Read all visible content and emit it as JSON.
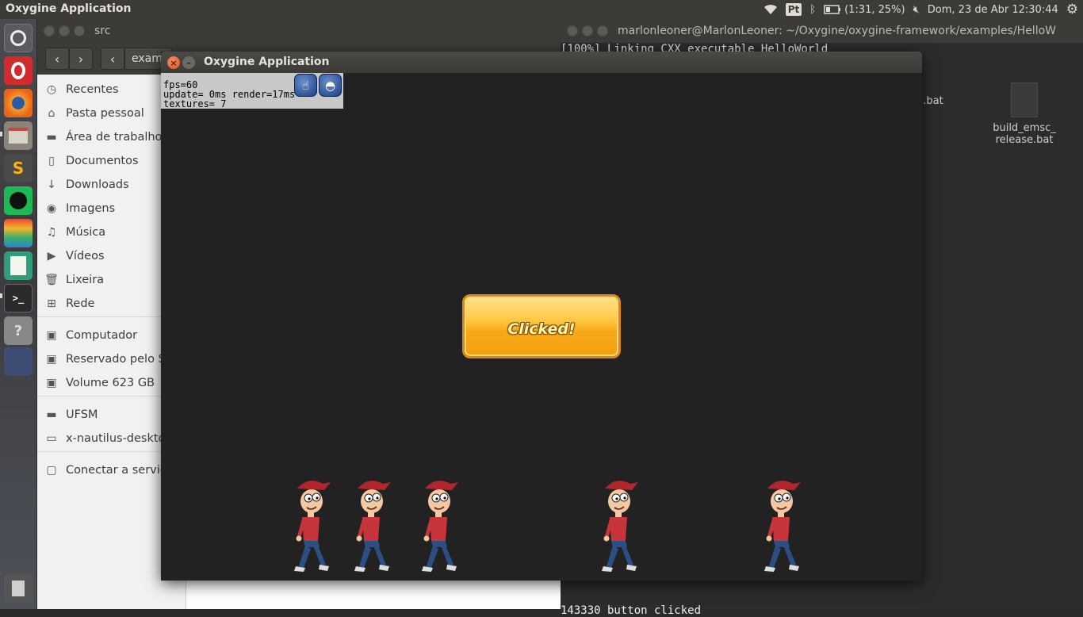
{
  "top_panel": {
    "app_title": "Oxygine Application",
    "keyboard_layout": "Pt",
    "battery": "(1:31, 25%)",
    "clock": "Dom, 23 de Abr 12:30:44"
  },
  "launcher": {
    "items": [
      "ubuntu-dash",
      "opera",
      "firefox",
      "files",
      "sublime-text",
      "spotify",
      "layers-app",
      "text-editor",
      "terminal",
      "help",
      "workspaces",
      "trash"
    ]
  },
  "files_window": {
    "title": "src",
    "path_segment": "exam",
    "sidebar": [
      {
        "icon": "clock-icon",
        "label": "Recentes"
      },
      {
        "icon": "home-icon",
        "label": "Pasta pessoal"
      },
      {
        "icon": "folder-icon",
        "label": "Área de trabalho"
      },
      {
        "icon": "document-icon",
        "label": "Documentos"
      },
      {
        "icon": "download-icon",
        "label": "Downloads"
      },
      {
        "icon": "camera-icon",
        "label": "Imagens"
      },
      {
        "icon": "music-icon",
        "label": "Música"
      },
      {
        "icon": "video-icon",
        "label": "Vídeos"
      },
      {
        "icon": "trash-icon",
        "label": "Lixeira"
      },
      {
        "icon": "network-icon",
        "label": "Rede"
      },
      {
        "icon": "drive-icon",
        "label": "Computador"
      },
      {
        "icon": "drive-icon",
        "label": "Reservado pelo Si"
      },
      {
        "icon": "drive-icon",
        "label": "Volume 623 GB"
      },
      {
        "icon": "folder-icon",
        "label": "UFSM"
      },
      {
        "icon": "desktop-icon",
        "label": "x-nautilus-deskto"
      },
      {
        "icon": "server-icon",
        "label": "Conectar a servid"
      }
    ]
  },
  "terminal": {
    "title": "marlonleoner@MarlonLeoner: ~/Oxygine/oxygine-framework/examples/HelloW",
    "line1": "[100%] Linking CXX executable HelloWorld",
    "output": "143330 button clicked",
    "files": [
      ".bat",
      "build_emsc_release.bat"
    ]
  },
  "oxygine_window": {
    "title": "Oxygine Application",
    "debug": {
      "fps": "fps=60",
      "update": "update= 0ms render=17ms",
      "textures": "textures= 7"
    },
    "button_label": "Clicked!",
    "walker_count": 5
  },
  "colors": {
    "panel": "#3c3b37",
    "canvas": "#222222",
    "button_orange": "#f6a617",
    "close_orange": "#d8521f"
  }
}
